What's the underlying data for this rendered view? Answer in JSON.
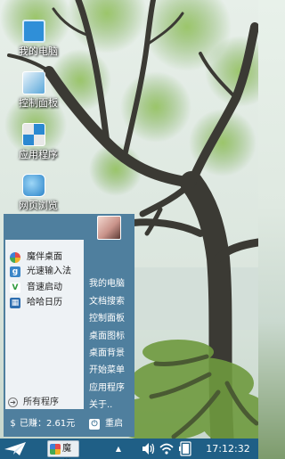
{
  "desktop": {
    "icons": [
      {
        "label": "我的电脑",
        "icon": "computer-icon"
      },
      {
        "label": "控制面板",
        "icon": "control-panel-icon"
      },
      {
        "label": "应用程序",
        "icon": "apps-icon"
      },
      {
        "label": "网页浏览",
        "icon": "browser-icon"
      }
    ]
  },
  "start_menu": {
    "apps": [
      {
        "label": "魔伴桌面",
        "icon": "mobandesktop-icon"
      },
      {
        "label": "光速输入法",
        "icon": "input-method-icon"
      },
      {
        "label": "音速启动",
        "icon": "launcher-icon"
      },
      {
        "label": "哈哈日历",
        "icon": "calendar-icon"
      }
    ],
    "all_programs": "所有程序",
    "links": [
      "我的电脑",
      "文档搜索",
      "控制面板",
      "桌面图标",
      "桌面背景",
      "开始菜单",
      "应用程序",
      "关于.."
    ],
    "earned": "已赚：2.61元",
    "restart": "重启"
  },
  "taskbar": {
    "app_label": "魔伴",
    "tray_up": "▲",
    "clock": "17:12:32"
  },
  "colors": {
    "menu_bg": "#4f7f9e",
    "taskbar_bg": "#1f5f86",
    "menu_list_bg": "#eef2f5"
  }
}
